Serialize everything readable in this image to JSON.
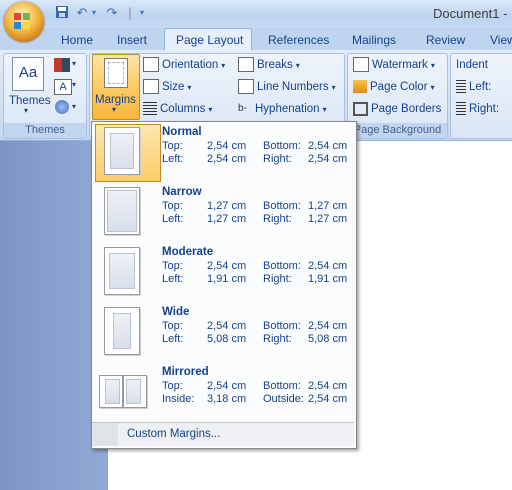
{
  "window": {
    "title": "Document1 - "
  },
  "qat": {
    "save_icon": "save-icon",
    "undo_icon": "undo-icon",
    "redo_icon": "redo-icon",
    "more_icon": "customize-qat-icon"
  },
  "tabs": [
    {
      "label": "Home"
    },
    {
      "label": "Insert"
    },
    {
      "label": "Page Layout",
      "active": true
    },
    {
      "label": "References"
    },
    {
      "label": "Mailings"
    },
    {
      "label": "Review"
    },
    {
      "label": "View"
    }
  ],
  "ribbon": {
    "themes": {
      "button_label": "Themes",
      "group_label": "Themes"
    },
    "page_setup": {
      "margins_label": "Margins",
      "orientation_label": "Orientation",
      "size_label": "Size",
      "columns_label": "Columns",
      "breaks_label": "Breaks",
      "line_numbers_label": "Line Numbers",
      "hyphenation_label": "Hyphenation"
    },
    "page_background": {
      "watermark_label": "Watermark",
      "page_color_label": "Page Color",
      "page_borders_label": "Page Borders",
      "group_label": "Page Background"
    },
    "paragraph": {
      "indent_label": "Indent",
      "left_label": "Left:",
      "right_label": "Right:"
    }
  },
  "margins_menu": {
    "items": [
      {
        "name": "Normal",
        "k1": "Top:",
        "v1": "2,54 cm",
        "k2": "Bottom:",
        "v2": "2,54 cm",
        "k3": "Left:",
        "v3": "2,54 cm",
        "k4": "Right:",
        "v4": "2,54 cm",
        "selected": true
      },
      {
        "name": "Narrow",
        "k1": "Top:",
        "v1": "1,27 cm",
        "k2": "Bottom:",
        "v2": "1,27 cm",
        "k3": "Left:",
        "v3": "1,27 cm",
        "k4": "Right:",
        "v4": "1,27 cm"
      },
      {
        "name": "Moderate",
        "k1": "Top:",
        "v1": "2,54 cm",
        "k2": "Bottom:",
        "v2": "2,54 cm",
        "k3": "Left:",
        "v3": "1,91 cm",
        "k4": "Right:",
        "v4": "1,91 cm"
      },
      {
        "name": "Wide",
        "k1": "Top:",
        "v1": "2,54 cm",
        "k2": "Bottom:",
        "v2": "2,54 cm",
        "k3": "Left:",
        "v3": "5,08 cm",
        "k4": "Right:",
        "v4": "5,08 cm"
      },
      {
        "name": "Mirrored",
        "k1": "Top:",
        "v1": "2,54 cm",
        "k2": "Bottom:",
        "v2": "2,54 cm",
        "k3": "Inside:",
        "v3": "3,18 cm",
        "k4": "Outside:",
        "v4": "2,54 cm"
      }
    ],
    "custom_label": "Custom Margins..."
  },
  "colors": {
    "accent_text": "#15428b",
    "highlight": "#fbc95e"
  }
}
